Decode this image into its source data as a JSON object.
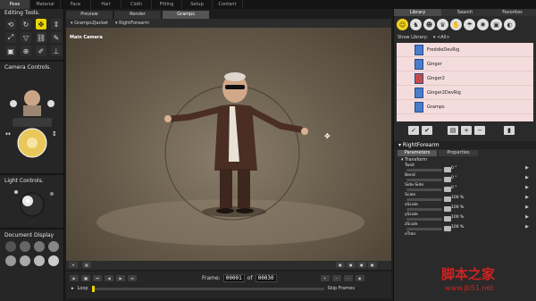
{
  "top_tabs": [
    "Pose",
    "Material",
    "Face",
    "Hair",
    "Cloth",
    "Fitting",
    "Setup",
    "Content"
  ],
  "left_panel": {
    "editing_tools_title": "Editing Tools",
    "camera_controls_title": "Camera Controls",
    "light_controls_title": "Light Controls",
    "document_display_title": "Document Display"
  },
  "viewport": {
    "tabs": [
      "Preview",
      "Render",
      "Gramps"
    ],
    "figure_select": "Gramps2Jacket",
    "actor_select": "RightForearm",
    "camera_label": "Main Camera"
  },
  "animation": {
    "frame_label": "Frame:",
    "current_frame": "00001",
    "of_label": "of",
    "total_frames": "00030",
    "loop_label": "Loop",
    "skip_frames_label": "Skip Frames"
  },
  "library": {
    "tabs": [
      "Library",
      "Search",
      "Favorites"
    ],
    "show_library_label": "Show Library:",
    "show_library_value": "<All>",
    "items": [
      "FreddieDevRig",
      "Ginger",
      "Ginger2",
      "Ginger2DevRig",
      "Gramps"
    ]
  },
  "parameters": {
    "actor_title": "RightForearm",
    "tabs": [
      "Parameters",
      "Properties"
    ],
    "section": "Transform",
    "params": [
      {
        "name": "Twist",
        "value": "0 °"
      },
      {
        "name": "Bend",
        "value": "0 °"
      },
      {
        "name": "Side-Side",
        "value": "0 °"
      },
      {
        "name": "Scale",
        "value": "100 %"
      },
      {
        "name": "xScale",
        "value": "100 %"
      },
      {
        "name": "yScale",
        "value": "100 %"
      },
      {
        "name": "zScale",
        "value": "100 %"
      },
      {
        "name": "xTran",
        "value": ""
      }
    ]
  },
  "watermark": {
    "cn_text": "脚本之家",
    "url": "www.jb51.net"
  },
  "colors": {
    "accent": "#e8d400",
    "library_bg": "#f4dcdc",
    "viewport_bg": "#6c604f"
  }
}
